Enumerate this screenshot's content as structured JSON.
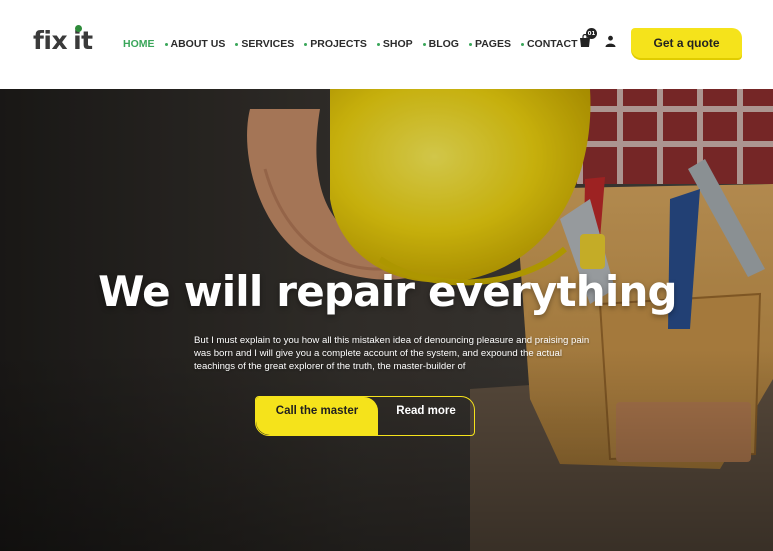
{
  "header": {
    "logo": {
      "part1": "fix",
      "part2": "it"
    },
    "nav": [
      {
        "label": "HOME",
        "active": true
      },
      {
        "label": "ABOUT US",
        "active": false
      },
      {
        "label": "SERVICES",
        "active": false
      },
      {
        "label": "PROJECTS",
        "active": false
      },
      {
        "label": "SHOP",
        "active": false
      },
      {
        "label": "BLOG",
        "active": false
      },
      {
        "label": "PAGES",
        "active": false
      },
      {
        "label": "CONTACT",
        "active": false
      }
    ],
    "cart": {
      "icon": "cart-icon",
      "count": "01"
    },
    "user": {
      "icon": "user-icon"
    },
    "quote_button": "Get a quote"
  },
  "hero": {
    "title": "We will repair everything",
    "text": "But I must explain to you how all this mistaken idea of denouncing pleasure and praising pain was born and I will give you a complete account of the system, and expound the actual teachings of the great explorer of the truth, the master-builder of",
    "primary_button": "Call the master",
    "secondary_button": "Read more"
  },
  "colors": {
    "accent_green": "#3aa65a",
    "accent_yellow": "#f5e31b",
    "text_dark": "#2b2b2b"
  }
}
